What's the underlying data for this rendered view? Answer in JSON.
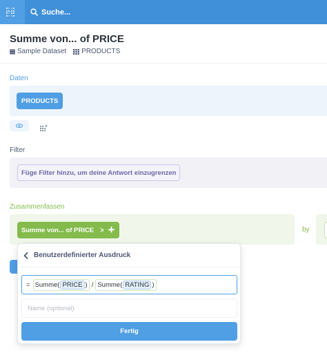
{
  "header": {
    "search_placeholder": "Suche..."
  },
  "question": {
    "title": "Summe von... of PRICE",
    "breadcrumbs": [
      "Sample Dataset",
      "PRODUCTS"
    ]
  },
  "sections": {
    "data_label": "Daten",
    "filter_label": "Filter",
    "summarize_label": "Zusammenfassen"
  },
  "data_step": {
    "table_button": "PRODUCTS"
  },
  "filter_step": {
    "placeholder_chip": "Füge Filter hinzu, um deine Antwort einzugrenzen"
  },
  "summarize_step": {
    "metric_chip": "Summe von... of PRICE",
    "remove_glyph": "✕",
    "add_glyph": "+",
    "by_label": "by"
  },
  "popover": {
    "title": "Benutzerdefinierter Ausdruck",
    "expression": {
      "equals": "=",
      "fn1": "Summe",
      "arg1": "PRICE",
      "operator": "/",
      "fn2": "Summe",
      "arg2": "RATING",
      "open_paren": "(",
      "close_paren": ")"
    },
    "name_placeholder": "Name (optional)",
    "done_button": "Fertig"
  },
  "colors": {
    "brand_blue": "#509ee3",
    "summarize_green": "#84bb4c",
    "filter_purple": "#7172ad"
  }
}
